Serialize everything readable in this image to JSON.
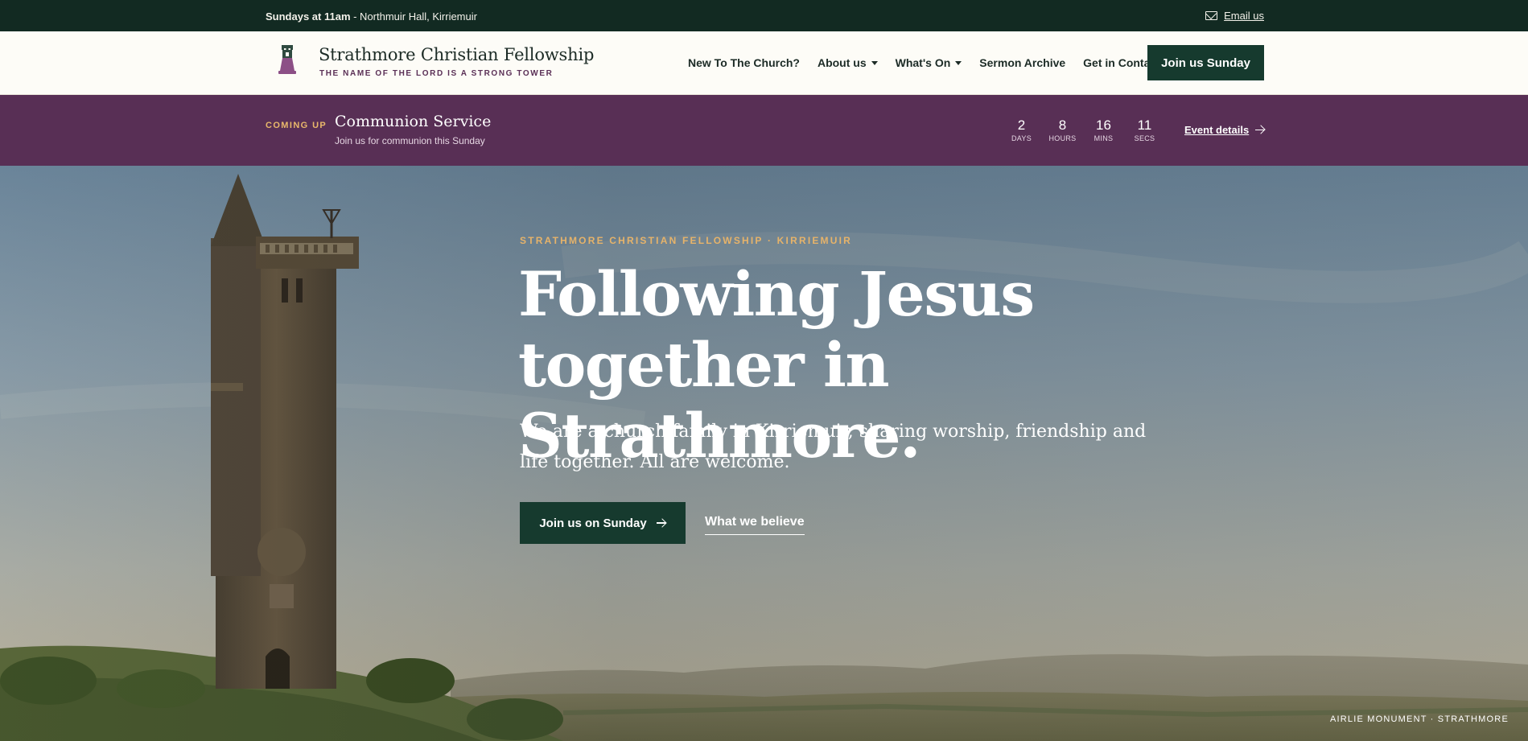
{
  "topbar": {
    "service_time": "Sundays at 11am",
    "location": " - Northmuir Hall, Kirriemuir",
    "email_link": "Email us"
  },
  "header": {
    "brand_name": "Strathmore Christian Fellowship",
    "brand_tagline": "THE NAME OF THE LORD IS A STRONG TOWER",
    "nav": [
      {
        "label": "New To The Church?",
        "dropdown": false
      },
      {
        "label": "About us",
        "dropdown": true
      },
      {
        "label": "What's On",
        "dropdown": true
      },
      {
        "label": "Sermon Archive",
        "dropdown": false
      },
      {
        "label": "Get in Contact",
        "dropdown": false
      }
    ],
    "cta_label": "Join us Sunday"
  },
  "event": {
    "kicker": "COMING UP",
    "title": "Communion Service",
    "subtitle": "Join us for communion this Sunday",
    "countdown": [
      {
        "value": "2",
        "unit": "DAYS"
      },
      {
        "value": "8",
        "unit": "HOURS"
      },
      {
        "value": "16",
        "unit": "MINS"
      },
      {
        "value": "11",
        "unit": "SECS"
      }
    ],
    "link_label": "Event details"
  },
  "hero": {
    "eyebrow": "STRATHMORE CHRISTIAN FELLOWSHIP · KIRRIEMUIR",
    "headline_line1": "Following Jesus",
    "headline_line2": "together in Strathmore.",
    "lede": "We are a church family in Kirriemuir, sharing worship, friendship and life together. All are welcome.",
    "primary_cta": "Join us on Sunday",
    "secondary_cta": "What we believe",
    "photo_caption": "AIRLIE MONUMENT · STRATHMORE"
  },
  "colors": {
    "forest": "#122a22",
    "button_green": "#163a2e",
    "plum": "#582f55",
    "gold": "#e6b36a",
    "cream": "#fdfcf7"
  }
}
